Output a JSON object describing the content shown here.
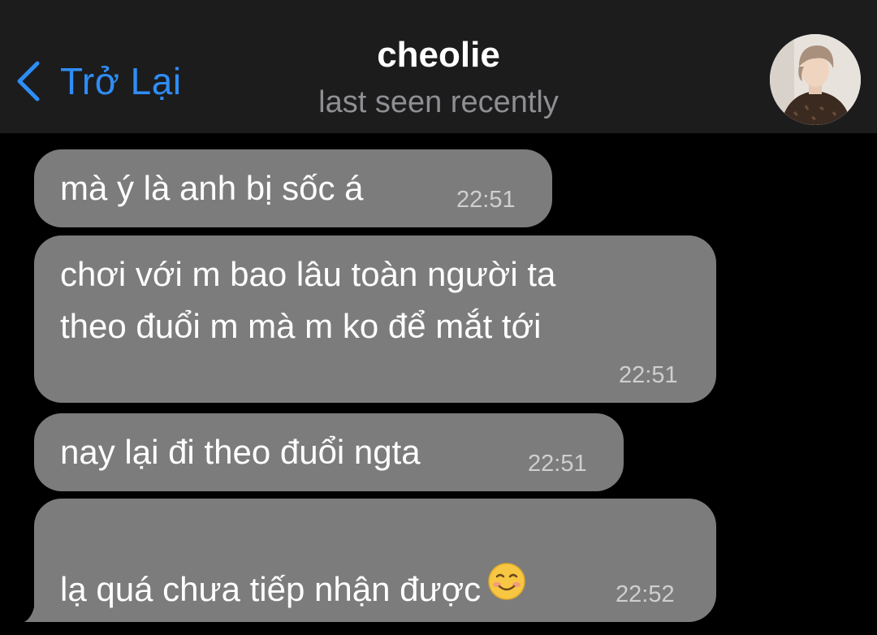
{
  "header": {
    "back_label": "Trở Lại",
    "title": "cheolie",
    "status": "last seen recently",
    "avatar_icon": "profile-photo"
  },
  "messages": [
    {
      "text": "mà ý là anh bị sốc á",
      "time": "22:51"
    },
    {
      "text": "chơi với m bao lâu toàn người ta\ntheo đuổi m mà m ko để mắt tới",
      "time": "22:51"
    },
    {
      "text": "nay lại đi theo đuổi ngta",
      "time": "22:51"
    },
    {
      "text": "lạ quá chưa tiếp nhận được",
      "time": "22:52",
      "emoji": "smiling-face-icon"
    }
  ],
  "colors": {
    "header_bg": "#1c1c1d",
    "accent": "#2f8df5",
    "bubble_bg": "#7c7c7d",
    "background": "#000000"
  }
}
